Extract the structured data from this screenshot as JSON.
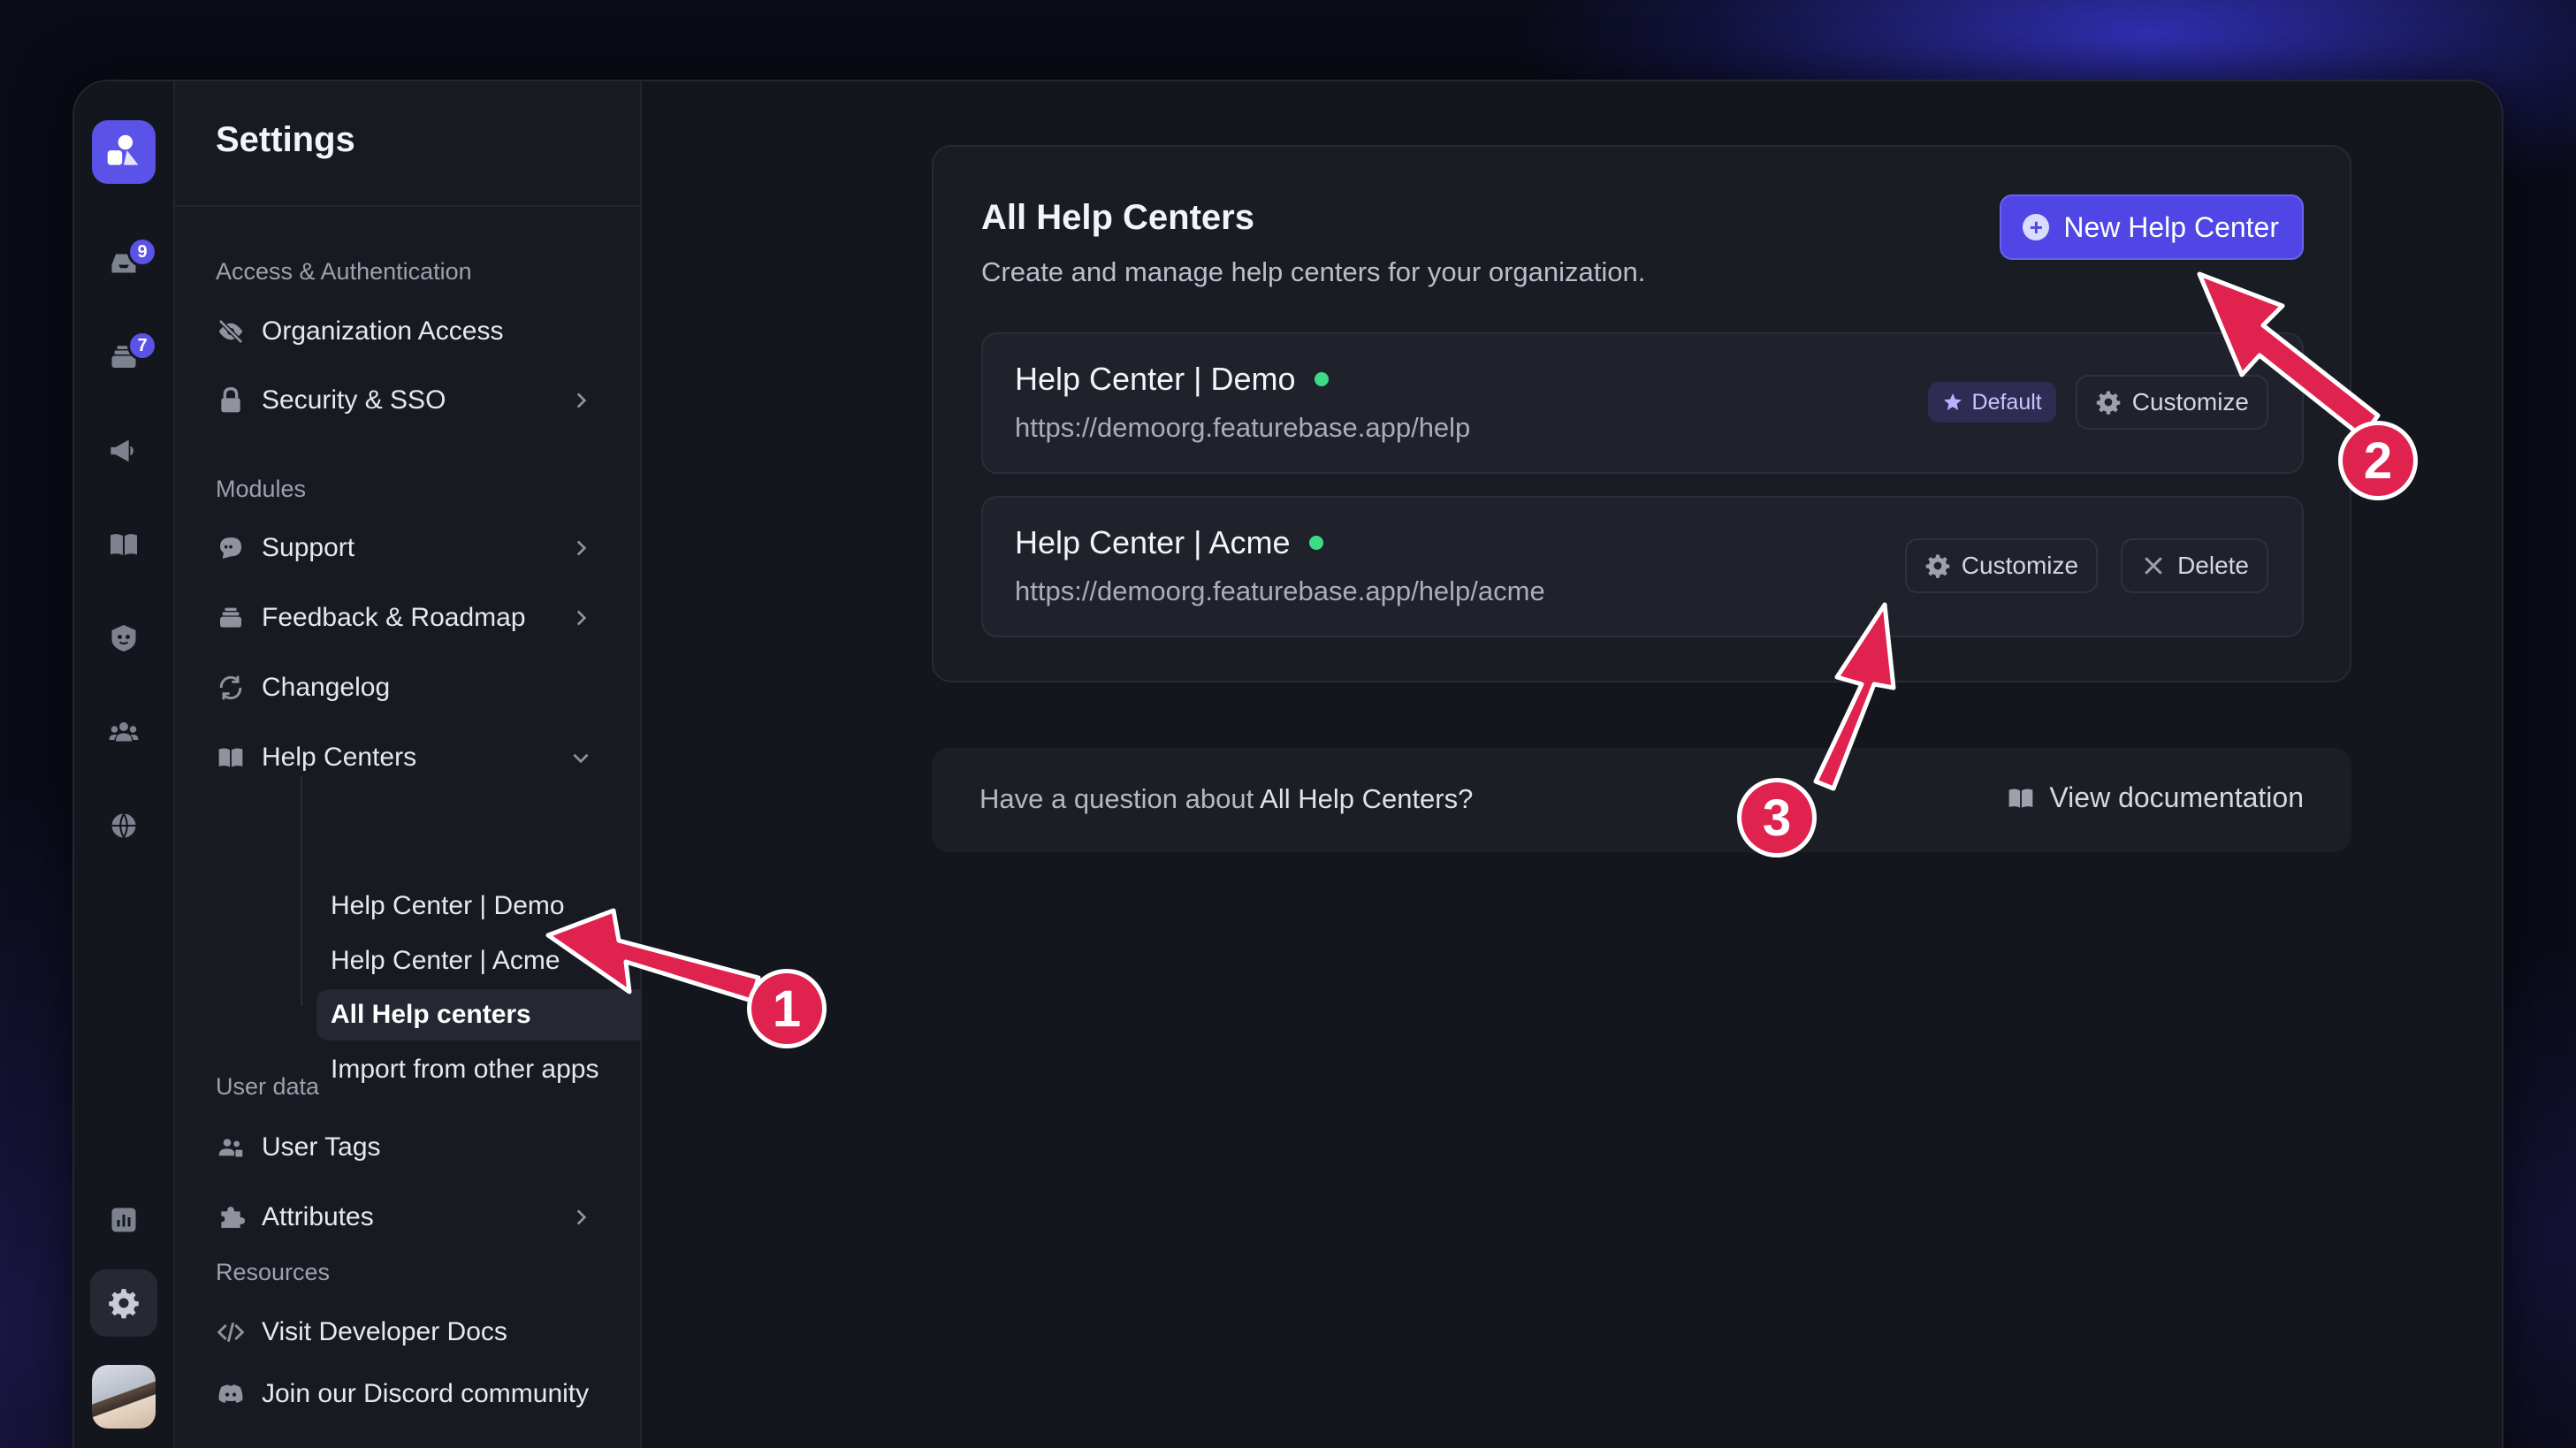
{
  "colors": {
    "accent": "#4f46e5",
    "online": "#3ddc84",
    "annotation": "#e0224e"
  },
  "rail": {
    "badges": {
      "inbox": "9",
      "feedback": "7"
    },
    "icons": [
      "logo-icon",
      "inbox-icon",
      "feedback-icon",
      "megaphone-icon",
      "book-icon",
      "bot-icon",
      "users-icon",
      "globe-icon",
      "chart-icon",
      "gear-icon"
    ]
  },
  "sidebar": {
    "title": "Settings",
    "sections": {
      "access": "Access & Authentication",
      "modules": "Modules",
      "user_data": "User data",
      "resources": "Resources"
    },
    "items": {
      "org_access": "Organization Access",
      "security": "Security & SSO",
      "support": "Support",
      "feedback": "Feedback & Roadmap",
      "changelog": "Changelog",
      "help_centers": "Help Centers",
      "user_tags": "User Tags",
      "attributes": "Attributes",
      "dev_docs": "Visit Developer Docs",
      "discord": "Join our Discord community"
    },
    "sub_items": {
      "demo": "Help Center | Demo",
      "acme": "Help Center | Acme",
      "all": "All Help centers",
      "import": "Import from other apps"
    }
  },
  "main": {
    "title": "All Help Centers",
    "subtitle": "Create and manage help centers for your organization.",
    "new_button": "New Help Center",
    "rows": [
      {
        "name": "Help Center | Demo",
        "url": "https://demoorg.featurebase.app/help",
        "default_label": "Default",
        "customize": "Customize"
      },
      {
        "name": "Help Center | Acme",
        "url": "https://demoorg.featurebase.app/help/acme",
        "customize": "Customize",
        "delete": "Delete"
      }
    ],
    "help": {
      "question_prefix": "Have a question about ",
      "question_topic": "All Help Centers?",
      "doc_link": "View documentation"
    }
  },
  "annotations": [
    "1",
    "2",
    "3"
  ]
}
